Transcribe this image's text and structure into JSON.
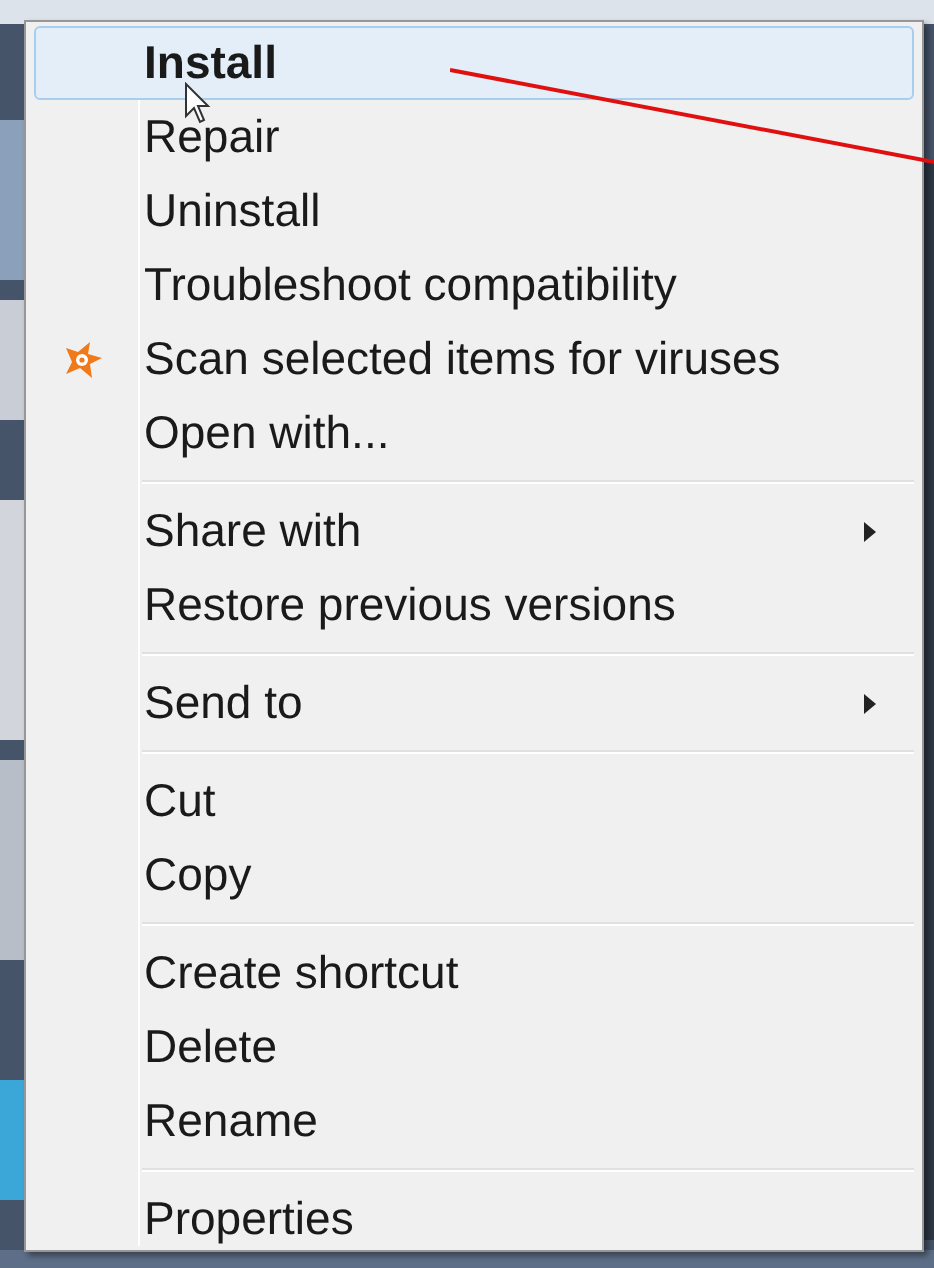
{
  "menu": {
    "groups": [
      {
        "items": [
          {
            "label": "Install",
            "selected": true,
            "default": true,
            "icon": false,
            "submenu": false
          },
          {
            "label": "Repair",
            "selected": false,
            "default": false,
            "icon": false,
            "submenu": false
          },
          {
            "label": "Uninstall",
            "selected": false,
            "default": false,
            "icon": false,
            "submenu": false
          },
          {
            "label": "Troubleshoot compatibility",
            "selected": false,
            "default": false,
            "icon": false,
            "submenu": false
          },
          {
            "label": "Scan selected items for viruses",
            "selected": false,
            "default": false,
            "icon": true,
            "submenu": false
          },
          {
            "label": "Open with...",
            "selected": false,
            "default": false,
            "icon": false,
            "submenu": false
          }
        ]
      },
      {
        "items": [
          {
            "label": "Share with",
            "selected": false,
            "default": false,
            "icon": false,
            "submenu": true
          },
          {
            "label": "Restore previous versions",
            "selected": false,
            "default": false,
            "icon": false,
            "submenu": false
          }
        ]
      },
      {
        "items": [
          {
            "label": "Send to",
            "selected": false,
            "default": false,
            "icon": false,
            "submenu": true
          }
        ]
      },
      {
        "items": [
          {
            "label": "Cut",
            "selected": false,
            "default": false,
            "icon": false,
            "submenu": false
          },
          {
            "label": "Copy",
            "selected": false,
            "default": false,
            "icon": false,
            "submenu": false
          }
        ]
      },
      {
        "items": [
          {
            "label": "Create shortcut",
            "selected": false,
            "default": false,
            "icon": false,
            "submenu": false
          },
          {
            "label": "Delete",
            "selected": false,
            "default": false,
            "icon": false,
            "submenu": false
          },
          {
            "label": "Rename",
            "selected": false,
            "default": false,
            "icon": false,
            "submenu": false
          }
        ]
      },
      {
        "items": [
          {
            "label": "Properties",
            "selected": false,
            "default": false,
            "icon": false,
            "submenu": false
          }
        ]
      }
    ]
  }
}
